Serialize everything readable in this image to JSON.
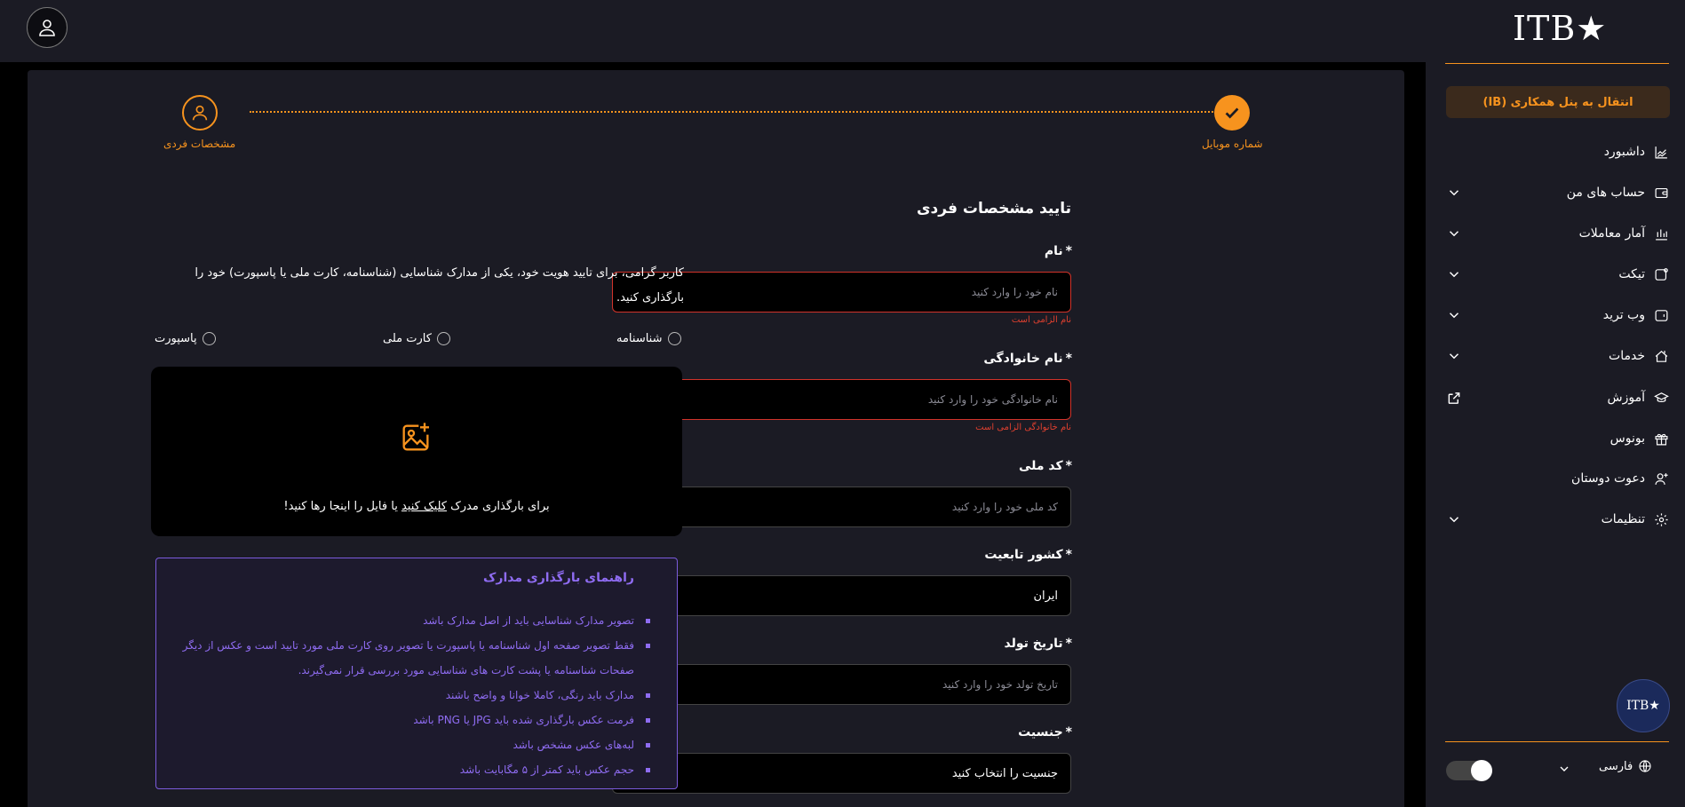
{
  "colors": {
    "accent": "#f7931e",
    "error": "#e0402f",
    "guide": "#8f6cf2",
    "panel": "#1b1b24"
  },
  "sidebar": {
    "logo": "ITB★",
    "ib_button": "انتقال به پنل همکاری (IB)",
    "items": [
      {
        "label": "داشبورد",
        "icon": "chart-icon",
        "chevron": false
      },
      {
        "label": "حساب های من",
        "icon": "wallet-icon",
        "chevron": true
      },
      {
        "label": "آمار معاملات",
        "icon": "bar-chart-icon",
        "chevron": true
      },
      {
        "label": "تیکت",
        "icon": "ticket-icon",
        "chevron": true
      },
      {
        "label": "وب ترید",
        "icon": "webtrade-icon",
        "chevron": true
      },
      {
        "label": "خدمات",
        "icon": "services-icon",
        "chevron": true
      },
      {
        "label": "آموزش",
        "icon": "graduation-icon",
        "chevron": false,
        "external": true
      },
      {
        "label": "بونوس",
        "icon": "gift-icon",
        "chevron": false
      },
      {
        "label": "دعوت دوستان",
        "icon": "user-plus-icon",
        "chevron": false
      },
      {
        "label": "تنظیمات",
        "icon": "gear-icon",
        "chevron": true
      }
    ],
    "badge": "ITB★",
    "language": "فارسی"
  },
  "stepper": {
    "steps": [
      {
        "label": "شماره موبایل",
        "state": "done"
      },
      {
        "label": "مشخصات فردی",
        "state": "current"
      }
    ]
  },
  "form": {
    "title": "تایید مشخصات فردی",
    "required_mark": "*",
    "first_name": {
      "label": "نام",
      "placeholder": "نام خود را وارد کنید",
      "error": "نام الزامی است"
    },
    "last_name": {
      "label": "نام خانوادگی",
      "placeholder": "نام خانوادگی خود را وارد کنید",
      "error": "نام خانوادگی الزامی است"
    },
    "national_code": {
      "label": "کد ملی",
      "placeholder": "کد ملی خود را وارد کنید"
    },
    "nationality": {
      "label": "کشور تابعیت",
      "value": "ایران"
    },
    "birth_date": {
      "label": "تاریخ تولد",
      "placeholder": "تاریخ تولد خود را وارد کنید"
    },
    "gender": {
      "label": "جنسیت",
      "value": "جنسیت را انتخاب کنید"
    }
  },
  "upload": {
    "intro": "کاربر گرامی، برای تایید هویت خود، یکی از مدارک شناسایی (شناسنامه، کارت ملی یا پاسپورت) خود را بارگذاری کنید.",
    "doc_types": [
      "شناسنامه",
      "کارت ملی",
      "پاسپورت"
    ],
    "drop_before": "برای بارگذاری مدرک ",
    "drop_link": "کلیک کنید",
    "drop_after": " یا فایل را اینجا رها کنید!",
    "guide_title": "راهنمای بارگذاری مدارک",
    "guide_items": [
      "تصویر مدارک شناسایی باید از اصل مدارک باشد",
      "فقط تصویر صفحه اول شناسنامه یا پاسپورت یا تصویر روی کارت ملی مورد تایید است و عکس از دیگر صفحات شناسنامه یا پشت کارت های شناسایی مورد بررسی قرار نمی‌گیرند.",
      "مدارک باید رنگی، کاملا خوانا و واضح باشند",
      "فرمت عکس بارگذاری شده باید JPG یا PNG باشد",
      "لبه‌های عکس مشخص باشد",
      "حجم عکس باید کمتر از ۵ مگابایت باشد"
    ]
  }
}
